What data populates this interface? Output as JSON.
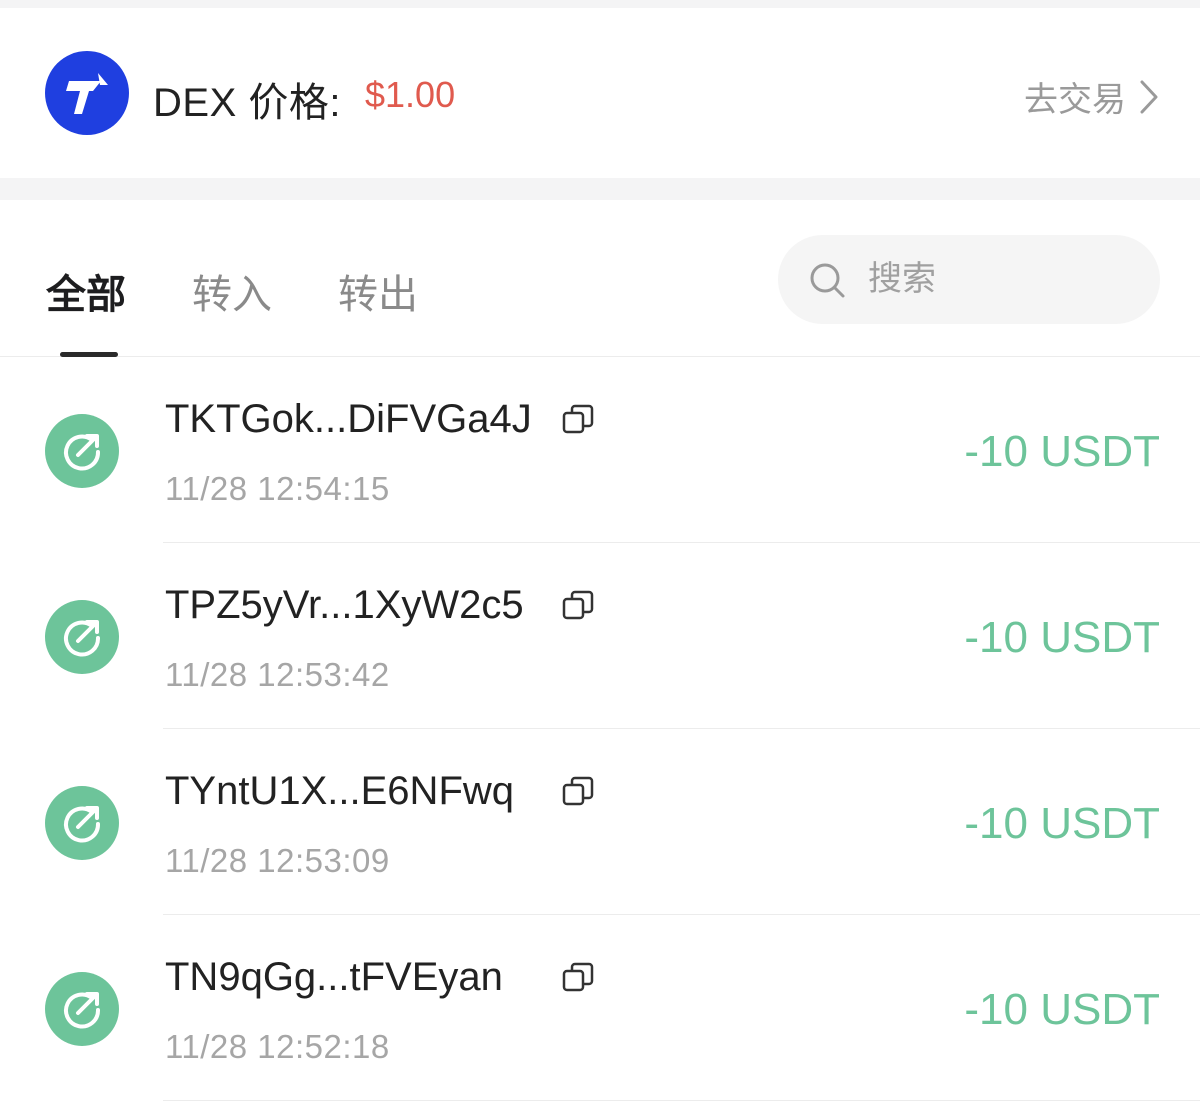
{
  "header": {
    "dex_label": "DEX 价格:",
    "dex_price": "$1.00",
    "trade_link": "去交易"
  },
  "tabs": [
    {
      "label": "全部",
      "active": true
    },
    {
      "label": "转入",
      "active": false
    },
    {
      "label": "转出",
      "active": false
    }
  ],
  "search": {
    "placeholder": "搜索"
  },
  "transactions": [
    {
      "address": "TKTGok...DiFVGa4J",
      "time": "11/28 12:54:15",
      "amount": "-10 USDT"
    },
    {
      "address": "TPZ5yVr...1XyW2c5",
      "time": "11/28 12:53:42",
      "amount": "-10 USDT"
    },
    {
      "address": "TYntU1X...E6NFwq",
      "time": "11/28 12:53:09",
      "amount": "-10 USDT"
    },
    {
      "address": "TN9qGg...tFVEyan",
      "time": "11/28 12:52:18",
      "amount": "-10 USDT"
    }
  ],
  "colors": {
    "brand_blue": "#1f3fe0",
    "price_red": "#e05a4e",
    "outgoing_green": "#6dc49a"
  },
  "icons": {
    "logo": "tronlink-logo-icon",
    "trade_arrow": "chevron-right-icon",
    "search": "search-icon",
    "tx_type": "send-arrow-icon",
    "copy": "copy-icon"
  }
}
